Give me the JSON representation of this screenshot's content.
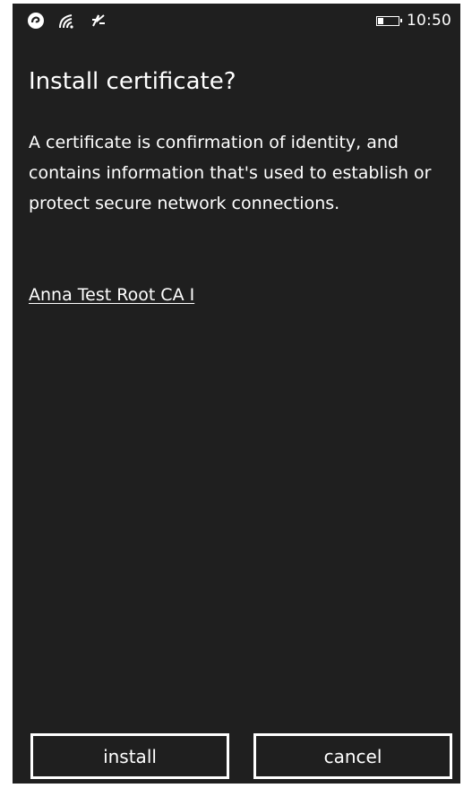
{
  "status_bar": {
    "icons": [
      "nfc-icon",
      "wifi-icon",
      "data-sense-icon"
    ],
    "battery_level": 0.3,
    "time": "10:50"
  },
  "dialog": {
    "title": "Install certificate?",
    "description": "A certificate is confirmation of identity, and contains information that's used to establish or protect secure network connections.",
    "certificate_name": "Anna Test Root CA I"
  },
  "buttons": {
    "install_label": "install",
    "cancel_label": "cancel"
  },
  "colors": {
    "background": "#1f1f1f",
    "foreground": "#ffffff"
  }
}
